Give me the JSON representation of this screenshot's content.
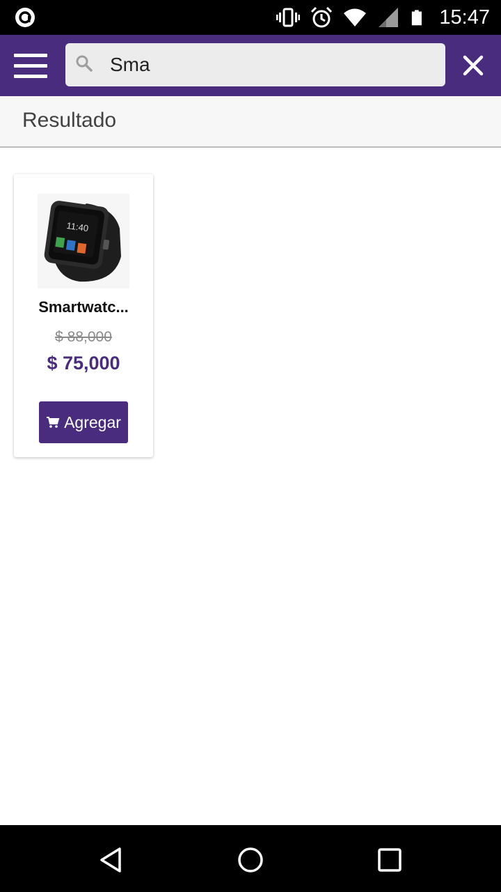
{
  "status_bar": {
    "time": "15:47",
    "icons": [
      "app-notification-icon",
      "vibrate-icon",
      "alarm-icon",
      "wifi-icon",
      "signal-icon",
      "battery-icon"
    ]
  },
  "app_bar": {
    "search_value": "Sma",
    "icons": [
      "menu-icon",
      "search-icon",
      "close-icon"
    ],
    "accent_color": "#4a2c7f"
  },
  "results": {
    "title": "Resultado"
  },
  "products": [
    {
      "name": "Smartwatc...",
      "old_price": "$ 88,000",
      "price": "$ 75,000",
      "add_label": "Agregar",
      "image": "smartwatch-image"
    }
  ],
  "nav_bar": {
    "icons": [
      "back-icon",
      "home-icon",
      "recents-icon"
    ]
  }
}
